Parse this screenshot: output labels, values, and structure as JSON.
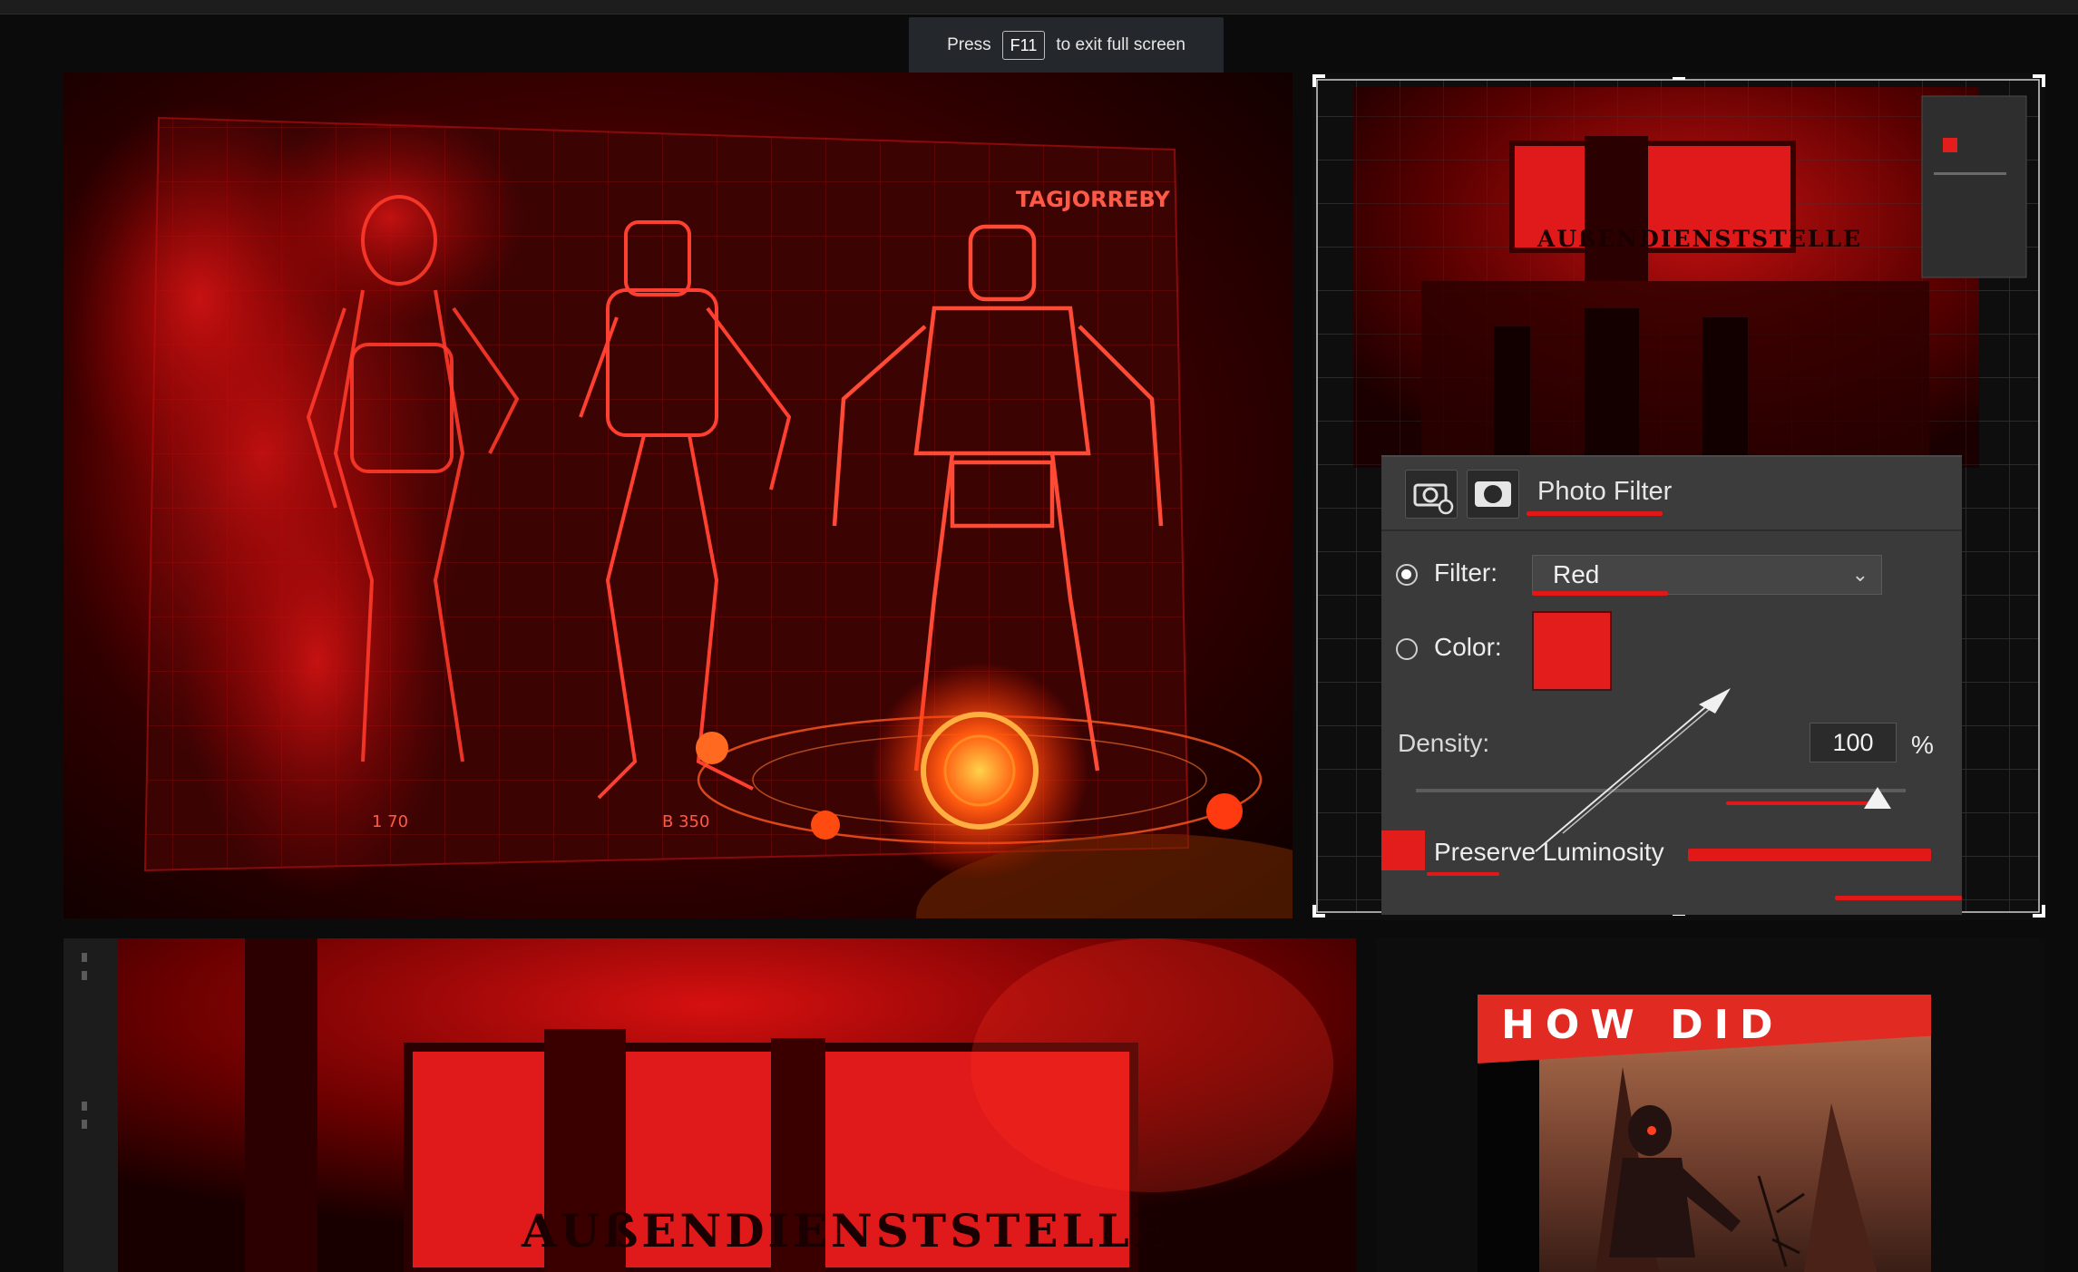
{
  "fullscreen_notice": {
    "prefix": "Press",
    "key": "F11",
    "suffix": "to exit full screen"
  },
  "gallery": {
    "tile1": {
      "alt": "Red holographic robot blueprint",
      "label_top": "TAGJORREBY",
      "label_left": "1 70",
      "label_mid": "B 350"
    },
    "tile2": {
      "sign_text": "AUßENDIENSTSTELLE",
      "photo_filter": {
        "title": "Photo Filter",
        "filter_label": "Filter:",
        "filter_value": "Red",
        "color_label": "Color:",
        "color_value": "#e31c1c",
        "density_label": "Density:",
        "density_value": "100",
        "density_unit": "%",
        "density_fraction": 1.0,
        "preserve_label": "Preserve Luminosity",
        "preserve_checked": true
      }
    },
    "tile3": {
      "sign_text": "AUßENDIENSTSTELLE"
    },
    "tile4": {
      "card_title": "HOW DID"
    }
  },
  "colors": {
    "accent_red": "#e01818",
    "banner_red": "#e12a22",
    "page_bg": "#0b0b0b"
  }
}
